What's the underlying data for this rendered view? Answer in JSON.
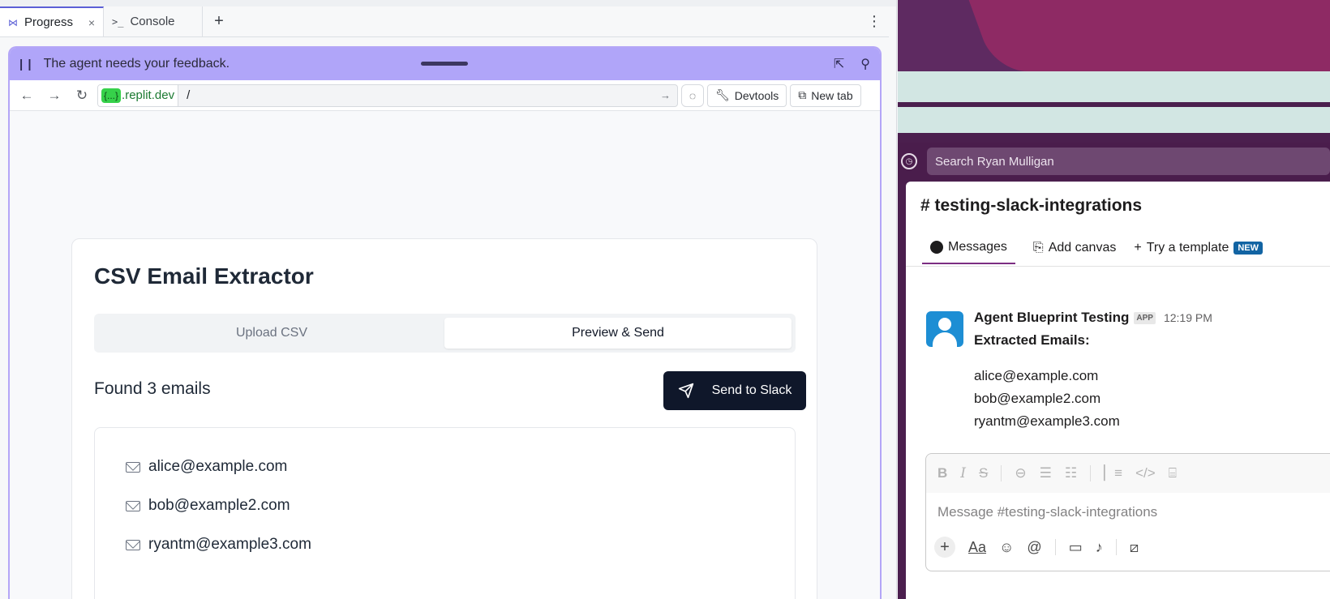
{
  "replit": {
    "tabs": [
      {
        "label": "Progress",
        "icon": "progress-icon",
        "active": true
      },
      {
        "label": "Console",
        "icon": "terminal-icon",
        "active": false
      }
    ],
    "add_tab": "+",
    "feedback_text": "The agent needs your feedback.",
    "url_host_chip": "{...}",
    "url_host": ".replit.dev",
    "url_path": "/",
    "devtools_label": "Devtools",
    "new_tab_label": "New tab"
  },
  "app": {
    "title": "CSV Email Extractor",
    "tab_upload": "Upload CSV",
    "tab_preview": "Preview & Send",
    "found_text": "Found 3 emails",
    "send_button": "Send to Slack",
    "emails": [
      "alice@example.com",
      "bob@example2.com",
      "ryantm@example3.com"
    ]
  },
  "slack": {
    "search_placeholder": "Search Ryan Mulligan",
    "channel": "# testing-slack-integrations",
    "tabs": {
      "messages": "Messages",
      "add_canvas": "Add canvas",
      "template": "Try a template",
      "new_badge": "NEW"
    },
    "message": {
      "sender": "Agent Blueprint Testing",
      "badge": "APP",
      "time": "12:19 PM",
      "heading": "Extracted Emails:",
      "emails": [
        "alice@example.com",
        "bob@example2.com",
        "ryantm@example3.com"
      ]
    },
    "composer_placeholder": "Message #testing-slack-integrations"
  },
  "colors": {
    "accent": "#5b5fd6",
    "feedback_bar": "#b0a5f9",
    "send_button": "#0f172a",
    "slack_aubergine": "#4a1d4c",
    "slack_new_badge": "#1264a3"
  }
}
